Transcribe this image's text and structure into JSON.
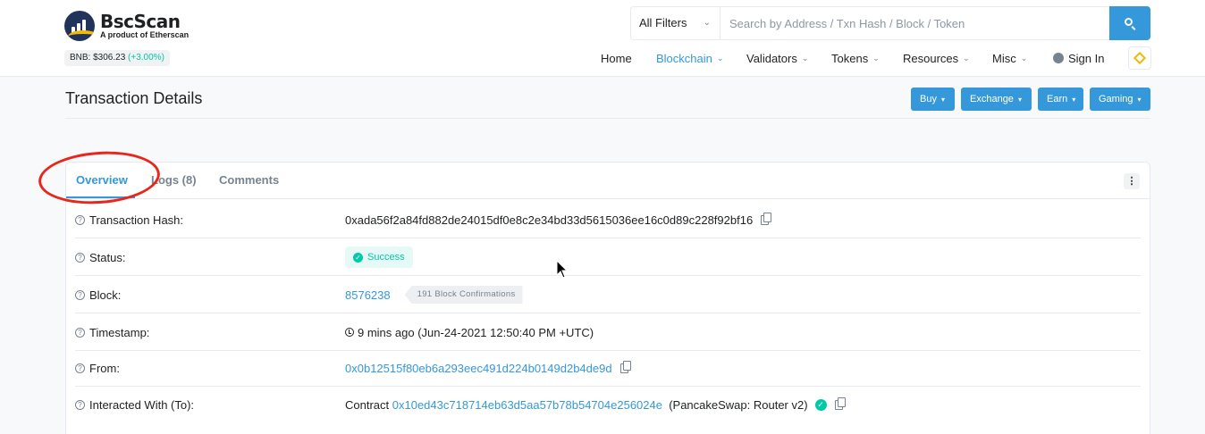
{
  "brand": {
    "name": "BscScan",
    "tagline": "A product of Etherscan"
  },
  "price": {
    "label": "BNB: $306.23",
    "change": "(+3.00%)"
  },
  "search": {
    "filter": "All Filters",
    "placeholder": "Search by Address / Txn Hash / Block / Token"
  },
  "nav": {
    "home": "Home",
    "blockchain": "Blockchain",
    "validators": "Validators",
    "tokens": "Tokens",
    "resources": "Resources",
    "misc": "Misc",
    "signin": "Sign In"
  },
  "page": {
    "title": "Transaction Details",
    "buttons": [
      "Buy",
      "Exchange",
      "Earn",
      "Gaming"
    ]
  },
  "tabs": [
    "Overview",
    "Logs (8)",
    "Comments"
  ],
  "details": {
    "hash_label": "Transaction Hash:",
    "hash": "0xada56f2a84fd882de24015df0e8c2e34bd33d5615036ee16c0d89c228f92bf16",
    "status_label": "Status:",
    "status": "Success",
    "block_label": "Block:",
    "block": "8576238",
    "confirmations": "191 Block Confirmations",
    "timestamp_label": "Timestamp:",
    "timestamp": "9 mins ago (Jun-24-2021 12:50:40 PM +UTC)",
    "from_label": "From:",
    "from": "0x0b12515f80eb6a293eec491d224b0149d2b4de9d",
    "to_label": "Interacted With (To):",
    "to_prefix": "Contract",
    "to_address": "0x10ed43c718714eb63d5aa57b78b54704e256024e",
    "to_name": "(PancakeSwap: Router v2)"
  },
  "colors": {
    "accent": "#3498db",
    "success": "#00c9a7",
    "annotation": "#e8261b",
    "bnb": "#f0b90b"
  },
  "icons": [
    "search-icon",
    "chevron-down-icon",
    "user-icon",
    "bnb-icon",
    "help-icon",
    "copy-icon",
    "check-icon",
    "clock-icon",
    "verified-icon",
    "kebab-icon",
    "cursor-icon"
  ]
}
